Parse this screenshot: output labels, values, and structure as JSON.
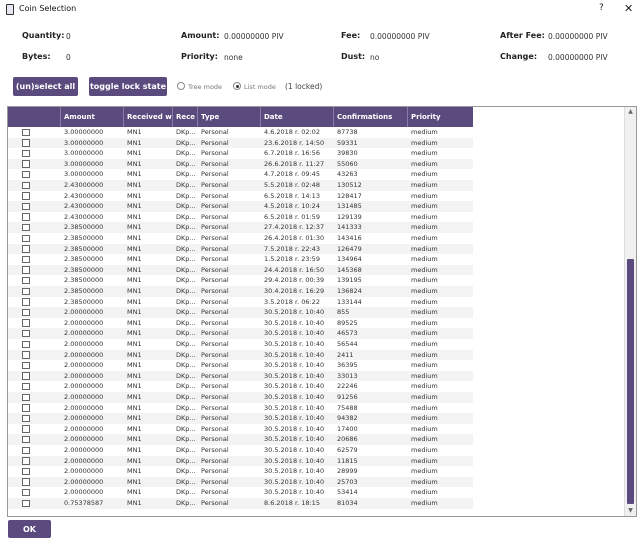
{
  "window": {
    "title": "Coin Selection",
    "help_label": "?",
    "close_label": "✕"
  },
  "summary": {
    "quantity_label": "Quantity:",
    "quantity_value": "0",
    "amount_label": "Amount:",
    "amount_value": "0.00000000 PIV",
    "fee_label": "Fee:",
    "fee_value": "0.00000000 PIV",
    "after_fee_label": "After Fee:",
    "after_fee_value": "0.00000000 PIV",
    "bytes_label": "Bytes:",
    "bytes_value": "0",
    "priority_label": "Priority:",
    "priority_value": "none",
    "dust_label": "Dust:",
    "dust_value": "no",
    "change_label": "Change:",
    "change_value": "0.00000000 PIV"
  },
  "controls": {
    "select_all_label": "(un)select all",
    "toggle_lock_label": "toggle lock state",
    "tree_mode_label": "Tree mode",
    "list_mode_label": "List mode",
    "locked_label": "(1 locked)",
    "ok_label": "OK"
  },
  "table": {
    "headers": [
      "",
      "Amount",
      "Received wi",
      "Rece",
      "Type",
      "Date",
      "Confirmations",
      "Priority"
    ],
    "rows": [
      [
        "3.00000000",
        "MN1",
        "DKp...",
        "Personal",
        "4.6.2018 r. 02:02",
        "87738",
        "medium"
      ],
      [
        "3.00000000",
        "MN1",
        "DKp...",
        "Personal",
        "23.6.2018 r. 14:50",
        "59331",
        "medium"
      ],
      [
        "3.00000000",
        "MN1",
        "DKp...",
        "Personal",
        "6.7.2018 r. 16:56",
        "39830",
        "medium"
      ],
      [
        "3.00000000",
        "MN1",
        "DKp...",
        "Personal",
        "26.6.2018 r. 11:27",
        "55060",
        "medium"
      ],
      [
        "3.00000000",
        "MN1",
        "DKp...",
        "Personal",
        "4.7.2018 r. 09:45",
        "43263",
        "medium"
      ],
      [
        "2.43000000",
        "MN1",
        "DKp...",
        "Personal",
        "5.5.2018 r. 02:48",
        "130512",
        "medium"
      ],
      [
        "2.43000000",
        "MN1",
        "DKp...",
        "Personal",
        "6.5.2018 r. 14:13",
        "128417",
        "medium"
      ],
      [
        "2.43000000",
        "MN1",
        "DKp...",
        "Personal",
        "4.5.2018 r. 10:24",
        "131485",
        "medium"
      ],
      [
        "2.43000000",
        "MN1",
        "DKp...",
        "Personal",
        "6.5.2018 r. 01:59",
        "129139",
        "medium"
      ],
      [
        "2.38500000",
        "MN1",
        "DKp...",
        "Personal",
        "27.4.2018 r. 12:37",
        "141333",
        "medium"
      ],
      [
        "2.38500000",
        "MN1",
        "DKp...",
        "Personal",
        "26.4.2018 r. 01:30",
        "143416",
        "medium"
      ],
      [
        "2.38500000",
        "MN1",
        "DKp...",
        "Personal",
        "7.5.2018 r. 22:43",
        "126479",
        "medium"
      ],
      [
        "2.38500000",
        "MN1",
        "DKp...",
        "Personal",
        "1.5.2018 r. 23:59",
        "134964",
        "medium"
      ],
      [
        "2.38500000",
        "MN1",
        "DKp...",
        "Personal",
        "24.4.2018 r. 16:50",
        "145368",
        "medium"
      ],
      [
        "2.38500000",
        "MN1",
        "DKp...",
        "Personal",
        "29.4.2018 r. 00:39",
        "139195",
        "medium"
      ],
      [
        "2.38500000",
        "MN1",
        "DKp...",
        "Personal",
        "30.4.2018 r. 16:29",
        "136824",
        "medium"
      ],
      [
        "2.38500000",
        "MN1",
        "DKp...",
        "Personal",
        "3.5.2018 r. 06:22",
        "133144",
        "medium"
      ],
      [
        "2.00000000",
        "MN1",
        "DKp...",
        "Personal",
        "30.5.2018 r. 10:40",
        "855",
        "medium"
      ],
      [
        "2.00000000",
        "MN1",
        "DKp...",
        "Personal",
        "30.5.2018 r. 10:40",
        "89525",
        "medium"
      ],
      [
        "2.00000000",
        "MN1",
        "DKp...",
        "Personal",
        "30.5.2018 r. 10:40",
        "46573",
        "medium"
      ],
      [
        "2.00000000",
        "MN1",
        "DKp...",
        "Personal",
        "30.5.2018 r. 10:40",
        "56544",
        "medium"
      ],
      [
        "2.00000000",
        "MN1",
        "DKp...",
        "Personal",
        "30.5.2018 r. 10:40",
        "2411",
        "medium"
      ],
      [
        "2.00000000",
        "MN1",
        "DKp...",
        "Personal",
        "30.5.2018 r. 10:40",
        "36395",
        "medium"
      ],
      [
        "2.00000000",
        "MN1",
        "DKp...",
        "Personal",
        "30.5.2018 r. 10:40",
        "33013",
        "medium"
      ],
      [
        "2.00000000",
        "MN1",
        "DKp...",
        "Personal",
        "30.5.2018 r. 10:40",
        "22246",
        "medium"
      ],
      [
        "2.00000000",
        "MN1",
        "DKp...",
        "Personal",
        "30.5.2018 r. 10:40",
        "91256",
        "medium"
      ],
      [
        "2.00000000",
        "MN1",
        "DKp...",
        "Personal",
        "30.5.2018 r. 10:40",
        "75488",
        "medium"
      ],
      [
        "2.00000000",
        "MN1",
        "DKp...",
        "Personal",
        "30.5.2018 r. 10:40",
        "94382",
        "medium"
      ],
      [
        "2.00000000",
        "MN1",
        "DKp...",
        "Personal",
        "30.5.2018 r. 10:40",
        "17400",
        "medium"
      ],
      [
        "2.00000000",
        "MN1",
        "DKp...",
        "Personal",
        "30.5.2018 r. 10:40",
        "20686",
        "medium"
      ],
      [
        "2.00000000",
        "MN1",
        "DKp...",
        "Personal",
        "30.5.2018 r. 10:40",
        "62579",
        "medium"
      ],
      [
        "2.00000000",
        "MN1",
        "DKp...",
        "Personal",
        "30.5.2018 r. 10:40",
        "11815",
        "medium"
      ],
      [
        "2.00000000",
        "MN1",
        "DKp...",
        "Personal",
        "30.5.2018 r. 10:40",
        "28999",
        "medium"
      ],
      [
        "2.00000000",
        "MN1",
        "DKp...",
        "Personal",
        "30.5.2018 r. 10:40",
        "25703",
        "medium"
      ],
      [
        "2.00000000",
        "MN1",
        "DKp...",
        "Personal",
        "30.5.2018 r. 10:40",
        "53414",
        "medium"
      ],
      [
        "0.75378587",
        "MN1",
        "DKp...",
        "Personal",
        "8.6.2018 r. 18:15",
        "81034",
        "medium"
      ]
    ]
  },
  "colors": {
    "accent": "#5b4a7d"
  },
  "icons": {
    "title": "wallet-icon",
    "scroll_up": "arrow-up-icon",
    "scroll_down": "arrow-down-icon"
  }
}
